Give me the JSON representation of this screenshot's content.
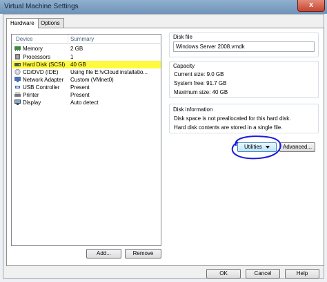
{
  "window": {
    "title": "Virtual Machine Settings",
    "close_glyph": "x"
  },
  "tabs": [
    {
      "label": "Hardware"
    },
    {
      "label": "Options"
    }
  ],
  "device_list": {
    "headers": {
      "device": "Device",
      "summary": "Summary"
    },
    "rows": [
      {
        "name": "Memory",
        "summary": "2 GB",
        "icon": "memory-icon"
      },
      {
        "name": "Processors",
        "summary": "1",
        "icon": "processor-icon"
      },
      {
        "name": "Hard Disk (SCSI)",
        "summary": "40 GB",
        "icon": "hard-disk-icon",
        "selected": true
      },
      {
        "name": "CD/DVD (IDE)",
        "summary": "Using file E:\\vCloud installatio...",
        "icon": "cd-dvd-icon"
      },
      {
        "name": "Network Adapter",
        "summary": "Custom (VMnet0)",
        "icon": "network-adapter-icon"
      },
      {
        "name": "USB Controller",
        "summary": "Present",
        "icon": "usb-controller-icon"
      },
      {
        "name": "Printer",
        "summary": "Present",
        "icon": "printer-icon"
      },
      {
        "name": "Display",
        "summary": "Auto detect",
        "icon": "display-icon"
      }
    ],
    "add_label": "Add...",
    "remove_label": "Remove"
  },
  "disk_file": {
    "label": "Disk file",
    "value": "Windows Server 2008.vmdk"
  },
  "capacity": {
    "label": "Capacity",
    "current": "Current size: 9.0 GB",
    "system_free": "System free: 91.7 GB",
    "maximum": "Maximum size: 40 GB"
  },
  "disk_information": {
    "label": "Disk information",
    "line1": "Disk space is not preallocated for this hard disk.",
    "line2": "Hard disk contents are stored in a single file."
  },
  "buttons": {
    "utilities": "Utilities",
    "advanced": "Advanced...",
    "ok": "OK",
    "cancel": "Cancel",
    "help": "Help"
  },
  "colors": {
    "selection_highlight": "#fffa3c",
    "annotation_circle": "#1a1adc"
  }
}
